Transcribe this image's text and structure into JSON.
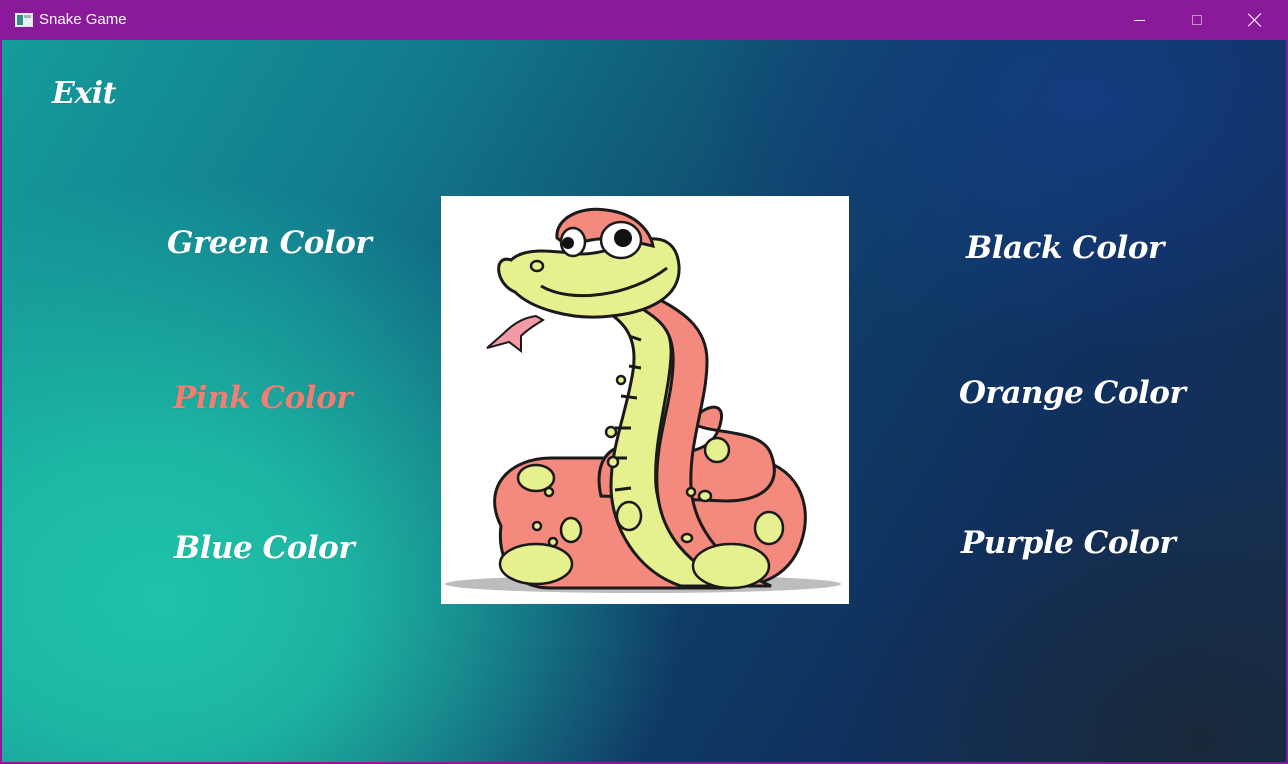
{
  "window": {
    "title": "Snake Game",
    "controls": {
      "minimize": "minimize",
      "maximize": "maximize",
      "close": "close"
    }
  },
  "menu": {
    "exit_label": "Exit",
    "left_options": [
      "Green Color",
      "Pink Color",
      "Blue Color"
    ],
    "right_options": [
      "Black Color",
      "Orange Color",
      "Purple Color"
    ],
    "highlighted_option": "Pink Color"
  },
  "colors": {
    "titlebar": "#8a1a9a",
    "menu_text": "#ffffff",
    "highlight_text": "#f07f73",
    "background_teal": "#1fc2a8",
    "background_navy": "#10305e",
    "snake_body": "#f4897d",
    "snake_belly": "#e6f08e"
  },
  "image": {
    "icon": "cartoon-snake-image"
  }
}
